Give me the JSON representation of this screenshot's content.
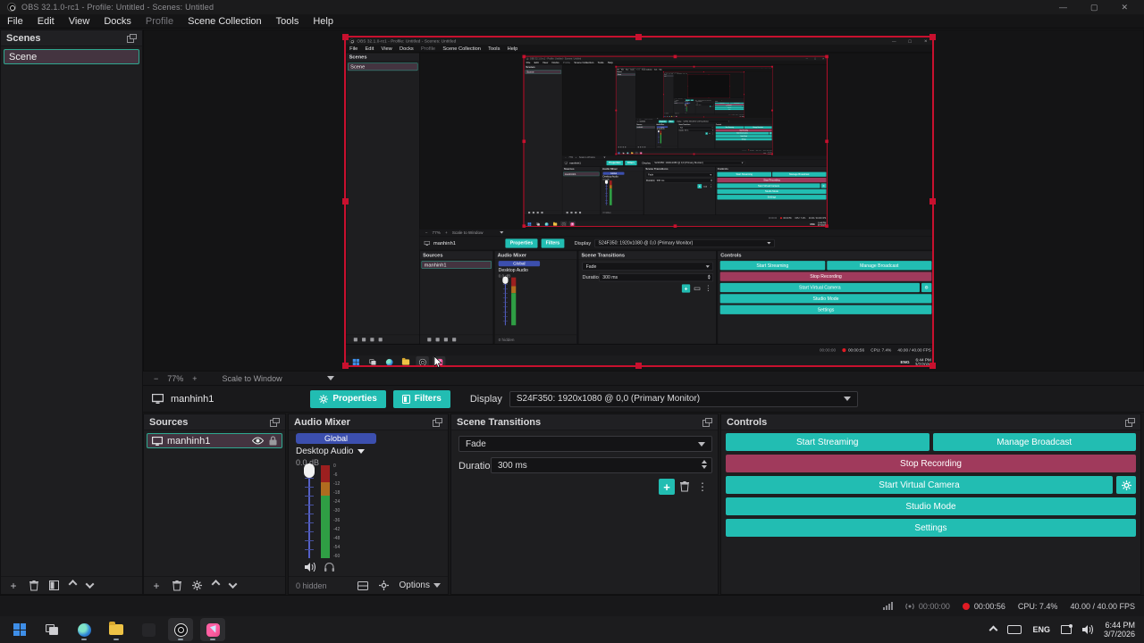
{
  "window": {
    "title": "OBS 32.1.0-rc1 - Profile: Untitled - Scenes: Untitled",
    "minimize": "—",
    "maximize": "▢",
    "close": "✕"
  },
  "menu": {
    "items": [
      {
        "label": "File"
      },
      {
        "label": "Edit"
      },
      {
        "label": "View"
      },
      {
        "label": "Docks"
      },
      {
        "label": "Profile",
        "disabled": true
      },
      {
        "label": "Scene Collection"
      },
      {
        "label": "Tools"
      },
      {
        "label": "Help"
      }
    ]
  },
  "scenes": {
    "title": "Scenes",
    "selected_scene": "Scene"
  },
  "preview": {
    "zoom_out": "−",
    "zoom_level": "77%",
    "zoom_in": "+",
    "scale_mode": "Scale to Window"
  },
  "context_bar": {
    "source_name": "manhinh1",
    "properties_label": "Properties",
    "filters_label": "Filters",
    "display_label": "Display",
    "display_value": "S24F350: 1920x1080 @ 0,0 (Primary Monitor)"
  },
  "sources": {
    "title": "Sources",
    "selected_source": "manhinh1"
  },
  "audio_mixer": {
    "title": "Audio Mixer",
    "badge": "Global",
    "device": "Desktop Audio",
    "level": "0.0 dB",
    "meter_ticks": [
      "0",
      "-6",
      "-12",
      "-18",
      "-24",
      "-30",
      "-36",
      "-42",
      "-48",
      "-54",
      "-60"
    ],
    "hidden_count": "0 hidden",
    "options_label": "Options"
  },
  "transitions": {
    "title": "Scene Transitions",
    "current": "Fade",
    "duration_label": "Duration",
    "duration_value": "300 ms"
  },
  "controls": {
    "title": "Controls",
    "start_streaming": "Start Streaming",
    "manage_broadcast": "Manage Broadcast",
    "stop_recording": "Stop Recording",
    "start_virtual_camera": "Start Virtual Camera",
    "studio_mode": "Studio Mode",
    "settings": "Settings"
  },
  "status_bar": {
    "stream_time": "00:00:00",
    "record_time": "00:00:56",
    "cpu": "CPU: 7.4%",
    "fps": "40.00 / 40.00 FPS"
  },
  "taskbar": {
    "language": "ENG",
    "time": "6:44 PM",
    "date": "3/7/2026"
  },
  "colors": {
    "accent_teal": "#22bdb2",
    "record_maroon": "#a03a5c",
    "selection_border": "#2fa890",
    "selection_bg": "#443440",
    "capture_border": "#c8102e",
    "record_dot": "#e01b24",
    "badge_blue": "#3c4fae"
  }
}
